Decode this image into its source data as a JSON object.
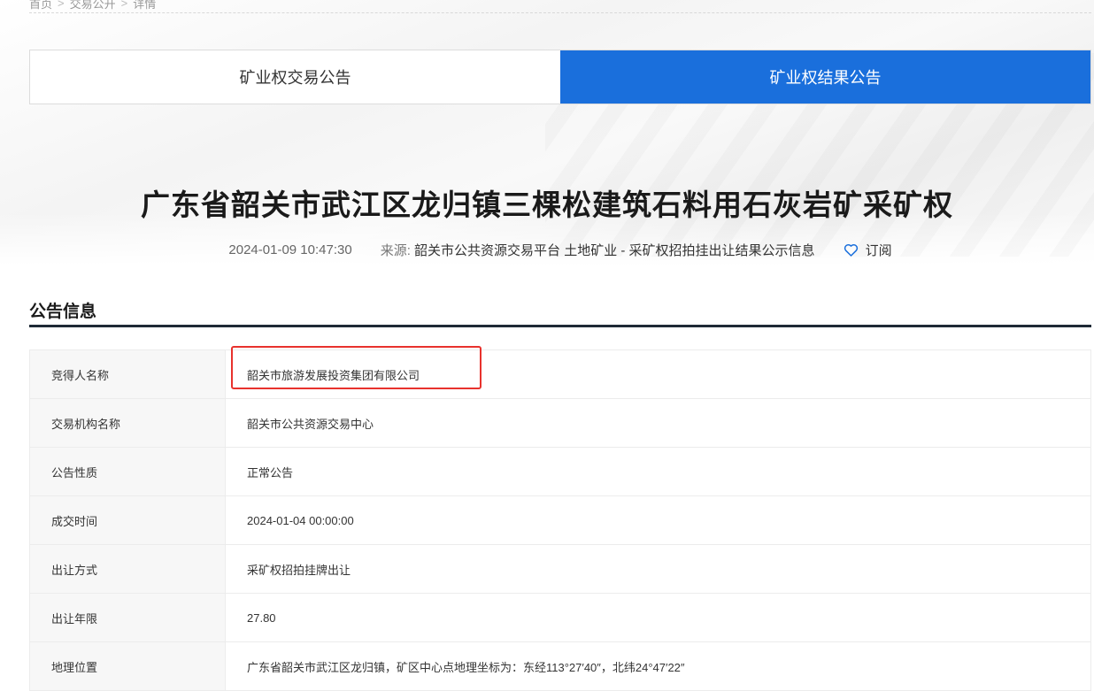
{
  "breadcrumb": {
    "items": [
      "首页",
      "交易公开",
      "详情"
    ]
  },
  "tabs": [
    {
      "label": "矿业权交易公告",
      "active": false
    },
    {
      "label": "矿业权结果公告",
      "active": true
    }
  ],
  "article": {
    "title": "广东省韶关市武江区龙归镇三棵松建筑石料用石灰岩矿采矿权",
    "datetime": "2024-01-09 10:47:30",
    "source_label": "来源:",
    "source_value": "韶关市公共资源交易平台 土地矿业 - 采矿权招拍挂出让结果公示信息",
    "subscribe_label": "订阅"
  },
  "section": {
    "title": "公告信息"
  },
  "info_rows": [
    {
      "label": "竞得人名称",
      "value": "韶关市旅游发展投资集团有限公司"
    },
    {
      "label": "交易机构名称",
      "value": "韶关市公共资源交易中心"
    },
    {
      "label": "公告性质",
      "value": "正常公告"
    },
    {
      "label": "成交时间",
      "value": "2024-01-04 00:00:00"
    },
    {
      "label": "出让方式",
      "value": "采矿权招拍挂牌出让"
    },
    {
      "label": "出让年限",
      "value": "27.80"
    },
    {
      "label": "地理位置",
      "value": "广东省韶关市武江区龙归镇，矿区中心点地理坐标为：东经113°27′40″，北纬24°47′22″"
    }
  ],
  "colors": {
    "accent": "#1a6fdc",
    "highlight": "#e8322d",
    "rule": "#1f2a36"
  }
}
